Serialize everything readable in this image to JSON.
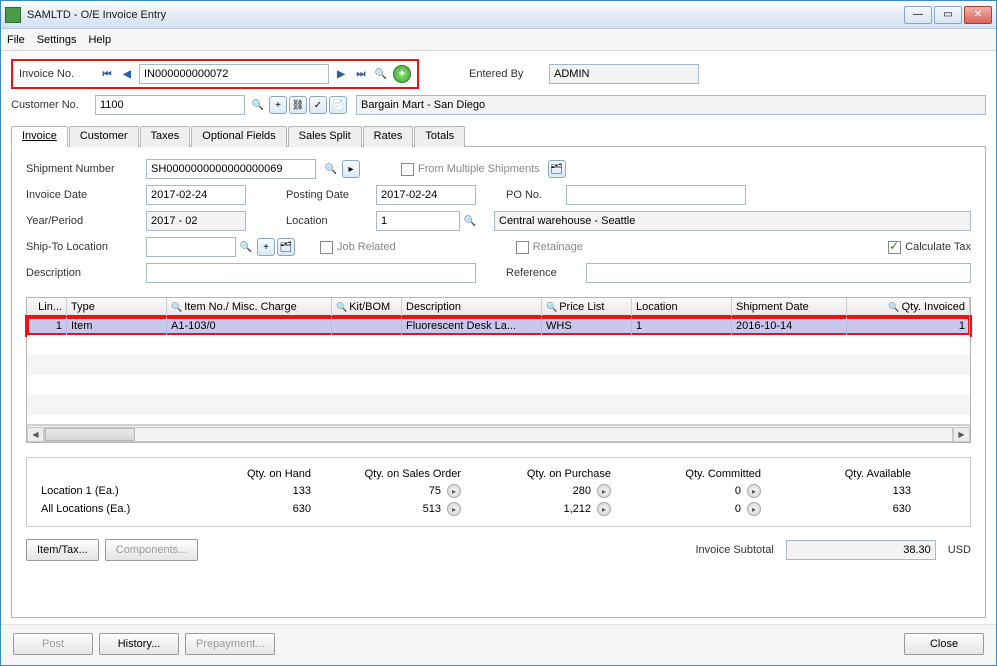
{
  "window": {
    "title": "SAMLTD - O/E Invoice Entry"
  },
  "menu": {
    "file": "File",
    "settings": "Settings",
    "help": "Help"
  },
  "top": {
    "invoice_no_label": "Invoice No.",
    "invoice_no": "IN000000000072",
    "entered_by_label": "Entered By",
    "entered_by": "ADMIN",
    "customer_no_label": "Customer No.",
    "customer_no": "1100",
    "customer_name": "Bargain Mart - San Diego"
  },
  "tabs": [
    "Invoice",
    "Customer",
    "Taxes",
    "Optional Fields",
    "Sales Split",
    "Rates",
    "Totals"
  ],
  "inv": {
    "shipment_label": "Shipment Number",
    "shipment": "SH0000000000000000069",
    "from_multi": "From Multiple Shipments",
    "invdate_label": "Invoice Date",
    "invdate": "2017-02-24",
    "postdate_label": "Posting Date",
    "postdate": "2017-02-24",
    "pono_label": "PO No.",
    "pono": "",
    "yp_label": "Year/Period",
    "yp": "2017 - 02",
    "loc_label": "Location",
    "loc": "1",
    "loc_desc": "Central warehouse - Seattle",
    "shipto_label": "Ship-To Location",
    "shipto": "",
    "jobrel": "Job Related",
    "retain": "Retainage",
    "calctax": "Calculate Tax",
    "desc_label": "Description",
    "desc": "",
    "ref_label": "Reference",
    "ref": ""
  },
  "grid": {
    "headers": {
      "line": "Lin...",
      "type": "Type",
      "item": "Item No./ Misc. Charge",
      "kit": "Kit/BOM",
      "desc": "Description",
      "price": "Price List",
      "loc": "Location",
      "shipdate": "Shipment Date",
      "qty": "Qty. Invoiced"
    },
    "row": {
      "line": "1",
      "type": "Item",
      "item": "A1-103/0",
      "kit": "",
      "desc": "Fluorescent Desk La...",
      "price": "WHS",
      "loc": "1",
      "shipdate": "2016-10-14",
      "qty": "1"
    }
  },
  "qty": {
    "h": [
      "",
      "Qty. on Hand",
      "Qty. on Sales Order",
      "Qty. on Purchase",
      "Qty. Committed",
      "Qty. Available"
    ],
    "r1": {
      "label": "Location  1 (Ea.)",
      "hand": "133",
      "order": "75",
      "purch": "280",
      "commit": "0",
      "avail": "133"
    },
    "r2": {
      "label": "All Locations (Ea.)",
      "hand": "630",
      "order": "513",
      "purch": "1,212",
      "commit": "0",
      "avail": "630"
    }
  },
  "btns": {
    "itemtax": "Item/Tax...",
    "components": "Components...",
    "subtotal_label": "Invoice Subtotal",
    "subtotal": "38.30",
    "currency": "USD"
  },
  "footer": {
    "post": "Post",
    "history": "History...",
    "prepay": "Prepayment...",
    "close": "Close"
  }
}
